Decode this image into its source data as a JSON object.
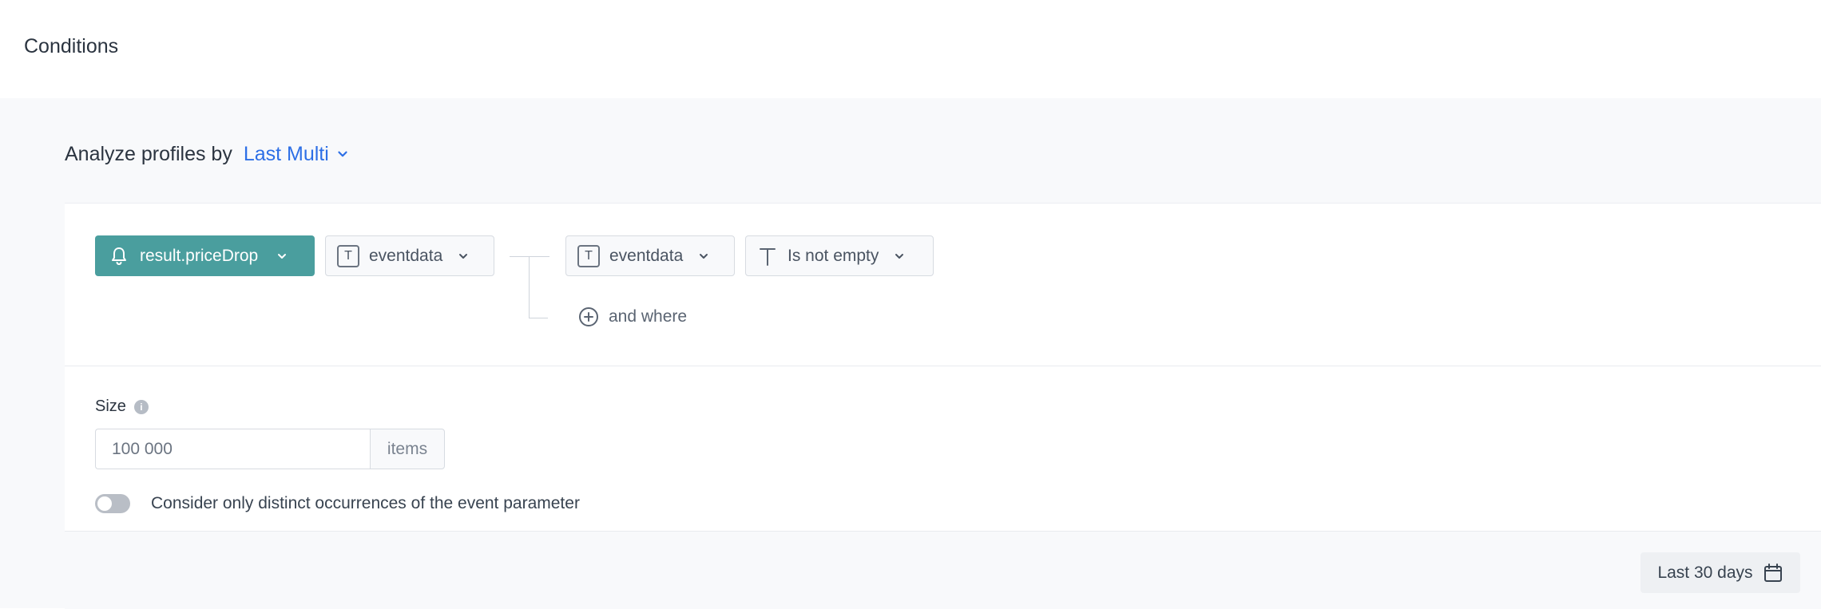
{
  "header": {
    "title": "Conditions"
  },
  "analyze": {
    "label": "Analyze profiles by",
    "selected": "Last Multi"
  },
  "conditions": {
    "event_button": "result.priceDrop",
    "param_select": "eventdata",
    "where_field": "eventdata",
    "operator": "Is not empty",
    "add_where": "and where"
  },
  "size": {
    "label": "Size",
    "value": "100 000",
    "placeholder": "100 000",
    "suffix": "items"
  },
  "distinct_toggle": {
    "label": "Consider only distinct occurrences of the event parameter",
    "enabled": false
  },
  "footer": {
    "date_range": "Last 30 days"
  },
  "colors": {
    "accent": "#4a9e9e",
    "link": "#2d6fe6"
  }
}
